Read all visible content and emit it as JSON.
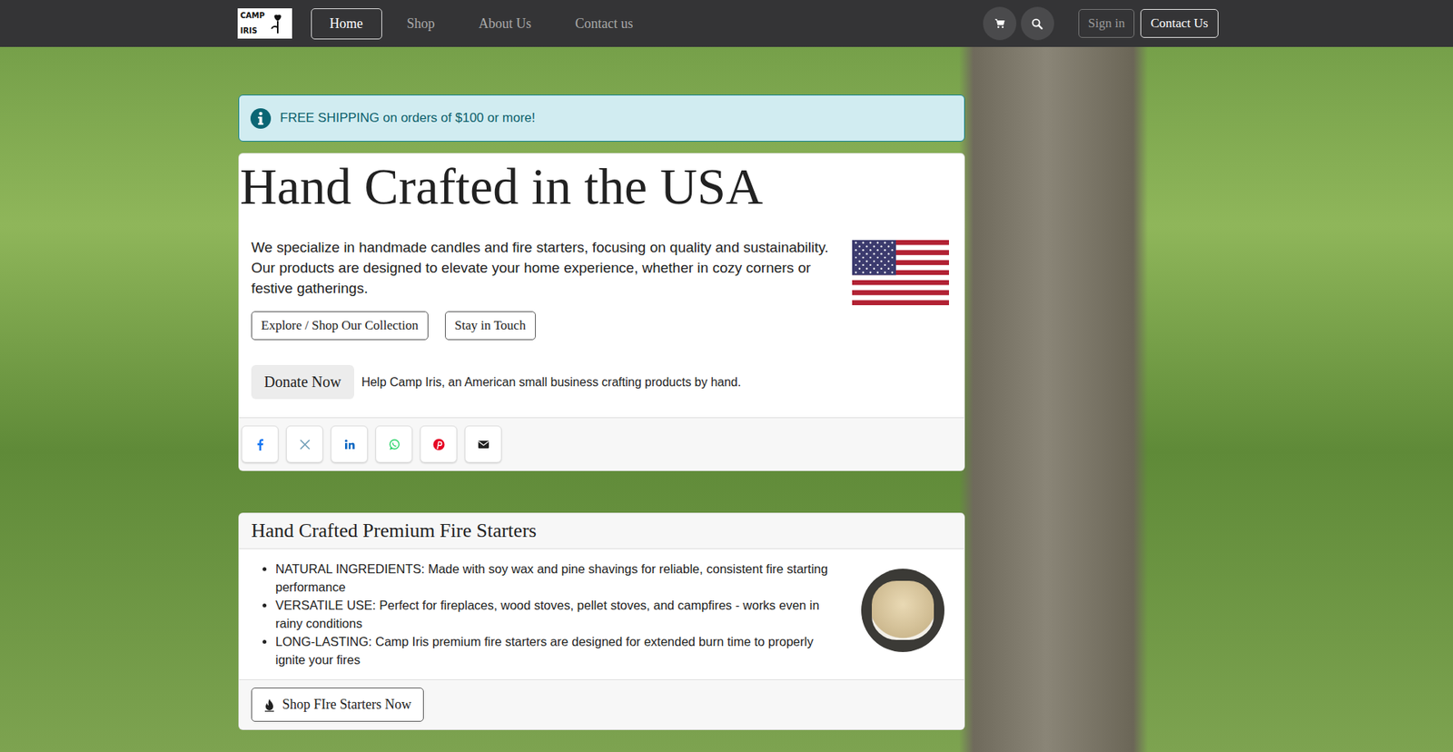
{
  "logo": {
    "lines": [
      "CAMP",
      "IRIS"
    ]
  },
  "nav": {
    "links": [
      {
        "label": "Home",
        "selected": true
      },
      {
        "label": "Shop",
        "selected": false
      },
      {
        "label": "About Us",
        "selected": false
      },
      {
        "label": "Contact us",
        "selected": false
      }
    ],
    "actions": [
      {
        "label": "Sign in",
        "muted": true
      },
      {
        "label": "Contact Us",
        "muted": false
      }
    ]
  },
  "alert": {
    "text": "FREE SHIPPING on orders of $100 or more!"
  },
  "hero": {
    "title": "Hand Crafted in the USA",
    "description": "We specialize in handmade candles and fire starters, focusing on quality and sustainability. Our products are designed to elevate your home experience, whether in cozy corners or festive gatherings.",
    "buttons": [
      "Explore / Shop Our Collection",
      "Stay in Touch"
    ],
    "donate": {
      "button": "Donate Now",
      "text": "Help Camp Iris, an American small business crafting products by hand."
    },
    "share": [
      {
        "kind": "facebook",
        "color": "#1877f2"
      },
      {
        "kind": "x",
        "color": "#6c9bb5"
      },
      {
        "kind": "linkedin",
        "color": "#0a66c2"
      },
      {
        "kind": "whatsapp",
        "color": "#25d366"
      },
      {
        "kind": "pinterest",
        "color": "#e60023"
      },
      {
        "kind": "email",
        "color": "#222222"
      }
    ]
  },
  "product": {
    "title": "Hand Crafted Premium Fire Starters",
    "bullets": [
      "NATURAL INGREDIENTS: Made with soy wax and pine shavings for reliable, consistent fire starting performance",
      "VERSATILE USE: Perfect for fireplaces, wood stoves, pellet stoves, and campfires - works even in rainy conditions",
      "LONG-LASTING: Camp Iris premium fire starters are designed for extended burn time to properly ignite your fires"
    ],
    "button": "Shop FIre Starters Now"
  }
}
